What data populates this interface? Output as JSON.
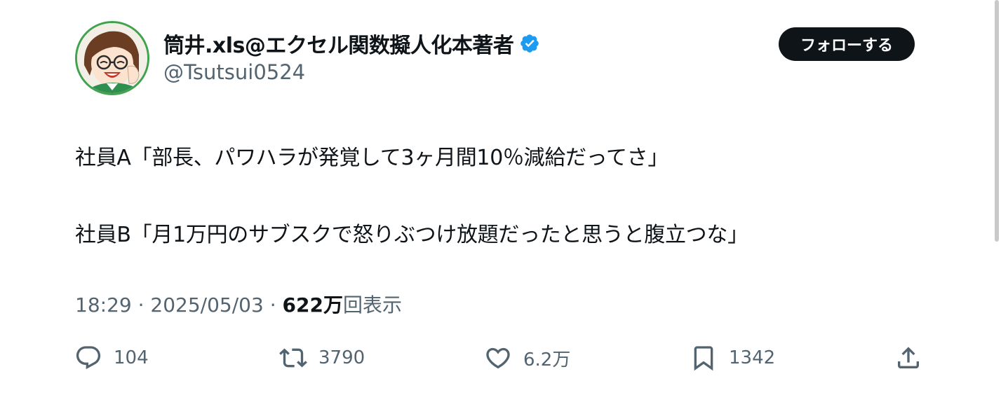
{
  "author": {
    "display_name": "筒井.xls@エクセル関数擬人化本著者",
    "handle": "@Tsutsui0524",
    "verified": true,
    "avatar": "avatar-illustration"
  },
  "follow_button": {
    "label": "フォローする"
  },
  "tweet": {
    "lines": [
      "社員A「部長、パワハラが発覚して3ヶ月間10％減給だってさ」",
      "社員B「月1万円のサブスクで怒りぶつけ放題だったと思うと腹立つな」"
    ]
  },
  "meta": {
    "time": "18:29",
    "separator": " · ",
    "date": "2025/05/03",
    "views_count": "622万",
    "views_label": "回表示"
  },
  "actions": {
    "reply": {
      "icon": "reply-icon",
      "count": "104"
    },
    "retweet": {
      "icon": "retweet-icon",
      "count": "3790"
    },
    "like": {
      "icon": "heart-icon",
      "count": "6.2万"
    },
    "bookmark": {
      "icon": "bookmark-icon",
      "count": "1342"
    },
    "share": {
      "icon": "share-icon"
    }
  },
  "colors": {
    "text": "#0f1419",
    "secondary": "#536471",
    "verified": "#1d9bf0",
    "button_bg": "#0f1419",
    "avatar_border": "#3fa34d"
  }
}
